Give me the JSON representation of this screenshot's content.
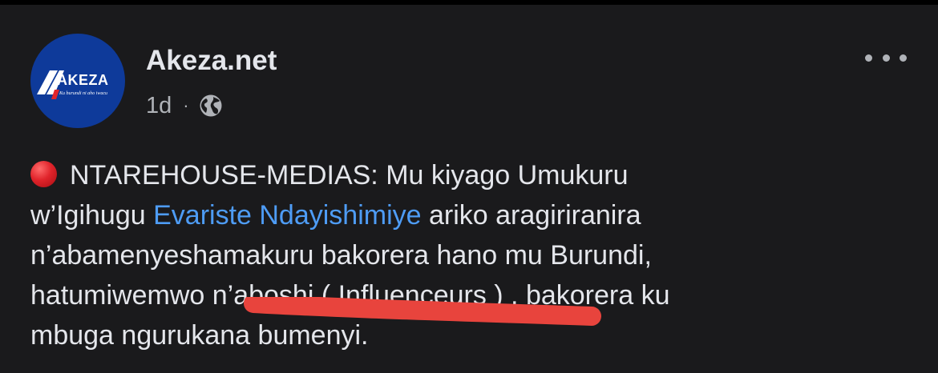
{
  "post": {
    "page_name": "Akeza.net",
    "timestamp": "1d",
    "separator": "·",
    "privacy_icon": "globe-icon",
    "menu_icon": "more-horizontal-icon",
    "avatar": {
      "logo_text": "AKEZA",
      "tagline": "Ku burundi ni aho iwacu",
      "bg_color": "#0e3a9a"
    },
    "text": {
      "lead_emoji": "red-circle-emoji",
      "line1": "NTAREHOUSE-MEDIAS: Mu kiyago Umukuru",
      "line2_before": "w’Igihugu ",
      "line2_mention": "Evariste Ndayishimiye",
      "line2_after": " ariko aragiriranira",
      "line3": "n’abamenyeshamakuru bakorera hano mu Burundi,",
      "line4": "hatumiwemwo n’aboshi ( Influenceurs ) , bakorera ku",
      "line5": "mbuga ngurukana bumenyi."
    },
    "annotation": {
      "type": "red-underline-stroke",
      "color": "#e8443d"
    }
  },
  "colors": {
    "background": "#1a1a1c",
    "text_primary": "#e4e6eb",
    "text_secondary": "#b0b3b8",
    "mention": "#4e9cf5"
  }
}
